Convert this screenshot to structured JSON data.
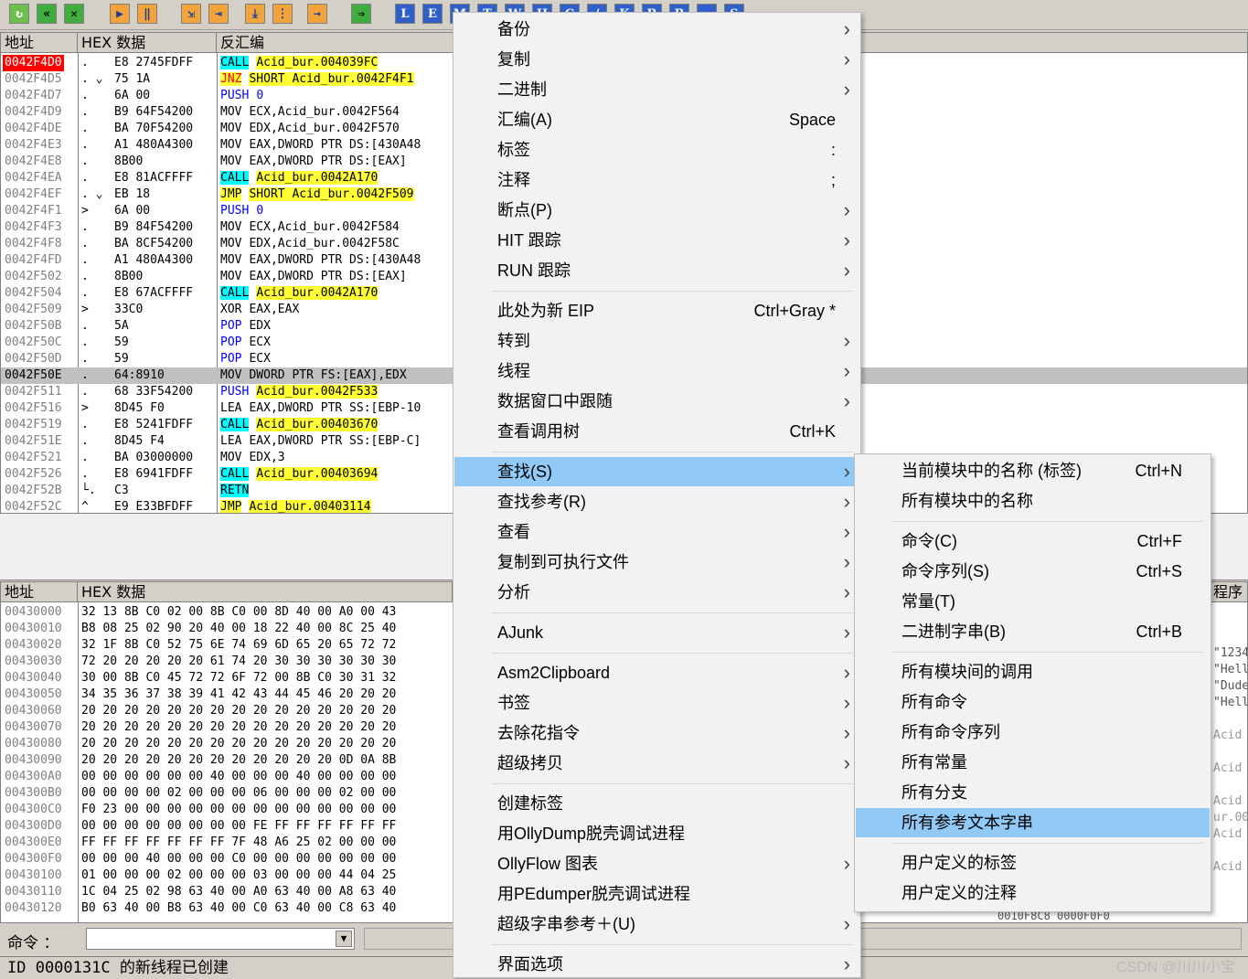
{
  "toolbar": {
    "letters": [
      "L",
      "E",
      "M",
      "T",
      "W",
      "H",
      "C",
      "/",
      "K",
      "B",
      "R",
      "...",
      "S"
    ]
  },
  "cpu": {
    "headers": {
      "addr": "地址",
      "hex": "HEX 数据",
      "asm": "反汇编"
    },
    "rows": [
      {
        "addr": "0042F4D0",
        "arrow": ".",
        "hex": "E8 2745FDFF",
        "m": "CALL",
        "ops": "Acid_bur.004039FC",
        "mcls": "hl-cyan",
        "ocls": "hl-yel"
      },
      {
        "addr": "0042F4D5",
        "arrow": ". ⌄",
        "hex": "75 1A",
        "m": "JNZ",
        "ops": "SHORT Acid_bur.0042F4F1",
        "mcls": "hl-yel kw-red",
        "ocls": "hl-yel"
      },
      {
        "addr": "0042F4D7",
        "arrow": ".",
        "hex": "6A 00",
        "m": "PUSH",
        "ops": "0",
        "mcls": "kw-blue",
        "ocls": "kw-blue"
      },
      {
        "addr": "0042F4D9",
        "arrow": ".",
        "hex": "B9 64F54200",
        "m": "MOV",
        "ops": "ECX,Acid_bur.0042F564",
        "mcls": "",
        "ocls": ""
      },
      {
        "addr": "0042F4DE",
        "arrow": ".",
        "hex": "BA 70F54200",
        "m": "MOV",
        "ops": "EDX,Acid_bur.0042F570",
        "mcls": "",
        "ocls": ""
      },
      {
        "addr": "0042F4E3",
        "arrow": ".",
        "hex": "A1 480A4300",
        "m": "MOV",
        "ops": "EAX,DWORD PTR DS:[430A48",
        "mcls": "",
        "ocls": ""
      },
      {
        "addr": "0042F4E8",
        "arrow": ".",
        "hex": "8B00",
        "m": "MOV",
        "ops": "EAX,DWORD PTR DS:[EAX]",
        "mcls": "",
        "ocls": ""
      },
      {
        "addr": "0042F4EA",
        "arrow": ".",
        "hex": "E8 81ACFFFF",
        "m": "CALL",
        "ops": "Acid_bur.0042A170",
        "mcls": "hl-cyan",
        "ocls": "hl-yel"
      },
      {
        "addr": "0042F4EF",
        "arrow": ". ⌄",
        "hex": "EB 18",
        "m": "JMP",
        "ops": "SHORT Acid_bur.0042F509",
        "mcls": "hl-yel",
        "ocls": "hl-yel"
      },
      {
        "addr": "0042F4F1",
        "arrow": ">",
        "hex": "6A 00",
        "m": "PUSH",
        "ops": "0",
        "mcls": "kw-blue",
        "ocls": "kw-blue"
      },
      {
        "addr": "0042F4F3",
        "arrow": ".",
        "hex": "B9 84F54200",
        "m": "MOV",
        "ops": "ECX,Acid_bur.0042F584",
        "mcls": "",
        "ocls": ""
      },
      {
        "addr": "0042F4F8",
        "arrow": ".",
        "hex": "BA 8CF54200",
        "m": "MOV",
        "ops": "EDX,Acid_bur.0042F58C",
        "mcls": "",
        "ocls": ""
      },
      {
        "addr": "0042F4FD",
        "arrow": ".",
        "hex": "A1 480A4300",
        "m": "MOV",
        "ops": "EAX,DWORD PTR DS:[430A48",
        "mcls": "",
        "ocls": ""
      },
      {
        "addr": "0042F502",
        "arrow": ".",
        "hex": "8B00",
        "m": "MOV",
        "ops": "EAX,DWORD PTR DS:[EAX]",
        "mcls": "",
        "ocls": ""
      },
      {
        "addr": "0042F504",
        "arrow": ".",
        "hex": "E8 67ACFFFF",
        "m": "CALL",
        "ops": "Acid_bur.0042A170",
        "mcls": "hl-cyan",
        "ocls": "hl-yel"
      },
      {
        "addr": "0042F509",
        "arrow": ">",
        "hex": "33C0",
        "m": "XOR",
        "ops": "EAX,EAX",
        "mcls": "",
        "ocls": ""
      },
      {
        "addr": "0042F50B",
        "arrow": ".",
        "hex": "5A",
        "m": "POP",
        "ops": "EDX",
        "mcls": "kw-blue",
        "ocls": ""
      },
      {
        "addr": "0042F50C",
        "arrow": ".",
        "hex": "59",
        "m": "POP",
        "ops": "ECX",
        "mcls": "kw-blue",
        "ocls": ""
      },
      {
        "addr": "0042F50D",
        "arrow": ".",
        "hex": "59",
        "m": "POP",
        "ops": "ECX",
        "mcls": "kw-blue",
        "ocls": ""
      },
      {
        "addr": "0042F50E",
        "arrow": ".",
        "hex": "64:8910",
        "m": "MOV",
        "ops": "DWORD PTR FS:[EAX],EDX",
        "mcls": "",
        "ocls": ""
      },
      {
        "addr": "0042F511",
        "arrow": ".",
        "hex": "68 33F54200",
        "m": "PUSH",
        "ops": "Acid_bur.0042F533",
        "mcls": "kw-blue",
        "ocls": "hl-yel"
      },
      {
        "addr": "0042F516",
        "arrow": ">",
        "hex": "8D45 F0",
        "m": "LEA",
        "ops": "EAX,DWORD PTR SS:[EBP-10",
        "mcls": "",
        "ocls": ""
      },
      {
        "addr": "0042F519",
        "arrow": ".",
        "hex": "E8 5241FDFF",
        "m": "CALL",
        "ops": "Acid_bur.00403670",
        "mcls": "hl-cyan",
        "ocls": "hl-yel"
      },
      {
        "addr": "0042F51E",
        "arrow": ".",
        "hex": "8D45 F4",
        "m": "LEA",
        "ops": "EAX,DWORD PTR SS:[EBP-C]",
        "mcls": "",
        "ocls": ""
      },
      {
        "addr": "0042F521",
        "arrow": ".",
        "hex": "BA 03000000",
        "m": "MOV",
        "ops": "EDX,3",
        "mcls": "",
        "ocls": ""
      },
      {
        "addr": "0042F526",
        "arrow": ".",
        "hex": "E8 6941FDFF",
        "m": "CALL",
        "ops": "Acid_bur.00403694",
        "mcls": "hl-cyan",
        "ocls": "hl-yel"
      },
      {
        "addr": "0042F52B",
        "arrow": "└.",
        "hex": "C3",
        "m": "RETN",
        "ops": "",
        "mcls": "hl-cyan",
        "ocls": ""
      },
      {
        "addr": "0042F52C",
        "arrow": "^",
        "hex": "E9 E33BFDFF",
        "m": "JMP",
        "ops": "Acid_bur.00403114",
        "mcls": "hl-yel",
        "ocls": "hl-yel"
      }
    ]
  },
  "dump": {
    "headers": {
      "addr": "地址",
      "hex": "HEX 数据"
    },
    "rows": [
      {
        "addr": "00430000",
        "hex": "32 13 8B C0 02 00 8B C0 00 8D 40 00 A0 00 43"
      },
      {
        "addr": "00430010",
        "hex": "B8 08 25 02 90 20 40 00 18 22 40 00 8C 25 40"
      },
      {
        "addr": "00430020",
        "hex": "32 1F 8B C0 52 75 6E 74 69 6D 65 20 65 72 72"
      },
      {
        "addr": "00430030",
        "hex": "72 20 20 20 20 20 61 74 20 30 30 30 30 30 30"
      },
      {
        "addr": "00430040",
        "hex": "30 00 8B C0 45 72 72 6F 72 00 8B C0 30 31 32"
      },
      {
        "addr": "00430050",
        "hex": "34 35 36 37 38 39 41 42 43 44 45 46 20 20 20"
      },
      {
        "addr": "00430060",
        "hex": "20 20 20 20 20 20 20 20 20 20 20 20 20 20 20"
      },
      {
        "addr": "00430070",
        "hex": "20 20 20 20 20 20 20 20 20 20 20 20 20 20 20"
      },
      {
        "addr": "00430080",
        "hex": "20 20 20 20 20 20 20 20 20 20 20 20 20 20 20"
      },
      {
        "addr": "00430090",
        "hex": "20 20 20 20 20 20 20 20 20 20 20 20 0D 0A 8B"
      },
      {
        "addr": "004300A0",
        "hex": "00 00 00 00 00 00 40 00 00 00 40 00 00 00 00"
      },
      {
        "addr": "004300B0",
        "hex": "00 00 00 00 02 00 00 00 06 00 00 00 02 00 00"
      },
      {
        "addr": "004300C0",
        "hex": "F0 23 00 00 00 00 00 00 00 00 00 00 00 00 00"
      },
      {
        "addr": "004300D0",
        "hex": "00 00 00 00 00 00 00 00 FE FF FF FF FF FF FF"
      },
      {
        "addr": "004300E0",
        "hex": "FF FF FF FF FF FF FF 7F 48 A6 25 02 00 00 00"
      },
      {
        "addr": "004300F0",
        "hex": "00 00 00 40 00 00 00 C0 00 00 00 00 00 00 00"
      },
      {
        "addr": "00430100",
        "hex": "01 00 00 00 02 00 00 00 03 00 00 00 44 04 25"
      },
      {
        "addr": "00430110",
        "hex": "1C 04 25 02 98 63 40 00 A0 63 40 00 A8 63 40"
      },
      {
        "addr": "00430120",
        "hex": "B0 63 40 00 B8 63 40 00 C0 63 40 00 C8 63 40"
      }
    ]
  },
  "right_snippets": {
    "label": "程序",
    "lines": [
      "\"1234",
      "\"Hell",
      "\"Dude",
      "\"Hell",
      "Acid",
      "Acid",
      "Acid",
      "ur.00",
      "Acid",
      "Acid"
    ],
    "footer": "0010F8C8  0000F0F0"
  },
  "command_bar": {
    "label": "命令 ："
  },
  "status": {
    "text": "ID 0000131C 的新线程已创建"
  },
  "watermark": "CSDN @川川小宝",
  "context_menu": {
    "groups": [
      [
        {
          "label": "备份",
          "shortcut": "",
          "submenu": true
        },
        {
          "label": "复制",
          "shortcut": "",
          "submenu": true
        },
        {
          "label": "二进制",
          "shortcut": "",
          "submenu": true
        },
        {
          "label": "汇编(A)",
          "shortcut": "Space",
          "submenu": false
        },
        {
          "label": "标签",
          "shortcut": ":",
          "submenu": false
        },
        {
          "label": "注释",
          "shortcut": ";",
          "submenu": false
        },
        {
          "label": "断点(P)",
          "shortcut": "",
          "submenu": true
        },
        {
          "label": "HIT 跟踪",
          "shortcut": "",
          "submenu": true
        },
        {
          "label": "RUN 跟踪",
          "shortcut": "",
          "submenu": true
        }
      ],
      [
        {
          "label": "此处为新 EIP",
          "shortcut": "Ctrl+Gray *",
          "submenu": false
        },
        {
          "label": "转到",
          "shortcut": "",
          "submenu": true
        },
        {
          "label": "线程",
          "shortcut": "",
          "submenu": true
        },
        {
          "label": "数据窗口中跟随",
          "shortcut": "",
          "submenu": true
        },
        {
          "label": "查看调用树",
          "shortcut": "Ctrl+K",
          "submenu": false
        }
      ],
      [
        {
          "label": "查找(S)",
          "shortcut": "",
          "submenu": true,
          "active": true
        },
        {
          "label": "查找参考(R)",
          "shortcut": "",
          "submenu": true
        },
        {
          "label": "查看",
          "shortcut": "",
          "submenu": true
        },
        {
          "label": "复制到可执行文件",
          "shortcut": "",
          "submenu": true
        },
        {
          "label": "分析",
          "shortcut": "",
          "submenu": true
        }
      ],
      [
        {
          "label": "AJunk",
          "shortcut": "",
          "submenu": true
        }
      ],
      [
        {
          "label": "Asm2Clipboard",
          "shortcut": "",
          "submenu": true
        },
        {
          "label": "书签",
          "shortcut": "",
          "submenu": true
        },
        {
          "label": "去除花指令",
          "shortcut": "",
          "submenu": true
        },
        {
          "label": "超级拷贝",
          "shortcut": "",
          "submenu": true
        }
      ],
      [
        {
          "label": "创建标签",
          "shortcut": "",
          "submenu": false
        },
        {
          "label": "用OllyDump脱壳调试进程",
          "shortcut": "",
          "submenu": false
        },
        {
          "label": "OllyFlow 图表",
          "shortcut": "",
          "submenu": true
        },
        {
          "label": "用PEdumper脱壳调试进程",
          "shortcut": "",
          "submenu": false
        },
        {
          "label": "超级字串参考＋(U)",
          "shortcut": "",
          "submenu": true
        }
      ],
      [
        {
          "label": "界面选项",
          "shortcut": "",
          "submenu": true
        }
      ]
    ]
  },
  "submenu": {
    "groups": [
      [
        {
          "label": "当前模块中的名称 (标签)",
          "shortcut": "Ctrl+N"
        },
        {
          "label": "所有模块中的名称",
          "shortcut": ""
        }
      ],
      [
        {
          "label": "命令(C)",
          "shortcut": "Ctrl+F"
        },
        {
          "label": "命令序列(S)",
          "shortcut": "Ctrl+S"
        },
        {
          "label": "常量(T)",
          "shortcut": ""
        },
        {
          "label": "二进制字串(B)",
          "shortcut": "Ctrl+B"
        }
      ],
      [
        {
          "label": "所有模块间的调用",
          "shortcut": ""
        },
        {
          "label": "所有命令",
          "shortcut": ""
        },
        {
          "label": "所有命令序列",
          "shortcut": ""
        },
        {
          "label": "所有常量",
          "shortcut": ""
        },
        {
          "label": "所有分支",
          "shortcut": ""
        },
        {
          "label": "所有参考文本字串",
          "shortcut": "",
          "active": true
        }
      ],
      [
        {
          "label": "用户定义的标签",
          "shortcut": ""
        },
        {
          "label": "用户定义的注释",
          "shortcut": ""
        }
      ]
    ]
  }
}
